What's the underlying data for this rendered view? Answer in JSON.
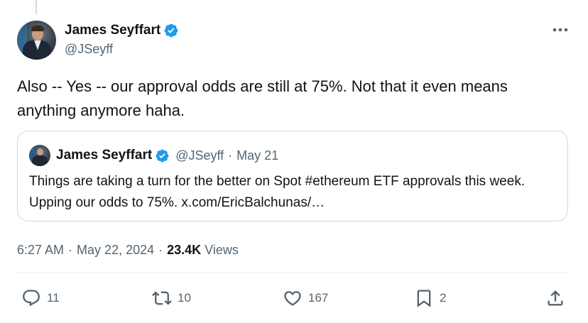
{
  "tweet": {
    "author": {
      "display_name": "James Seyffart",
      "handle": "@JSeyff",
      "verified": true
    },
    "text": "Also -- Yes -- our approval odds are still at 75%. Not that it even means anything anymore haha.",
    "quoted": {
      "display_name": "James Seyffart",
      "handle": "@JSeyff",
      "separator": "·",
      "date": "May 21",
      "text": "Things are taking a turn for the better on Spot #ethereum ETF approvals this week. Upping our odds to 75%. x.com/EricBalchunas/…"
    },
    "meta": {
      "time": "6:27 AM",
      "separator": "·",
      "date": "May 22, 2024",
      "views_count": "23.4K",
      "views_label": "Views"
    },
    "actions": {
      "replies": "11",
      "reposts": "10",
      "likes": "167",
      "bookmarks": "2"
    }
  },
  "icons": {
    "verified_color": "#1d9bf0",
    "more": "more-icon",
    "reply": "reply-icon",
    "repost": "repost-icon",
    "like": "like-icon",
    "bookmark": "bookmark-icon",
    "share": "share-icon"
  }
}
